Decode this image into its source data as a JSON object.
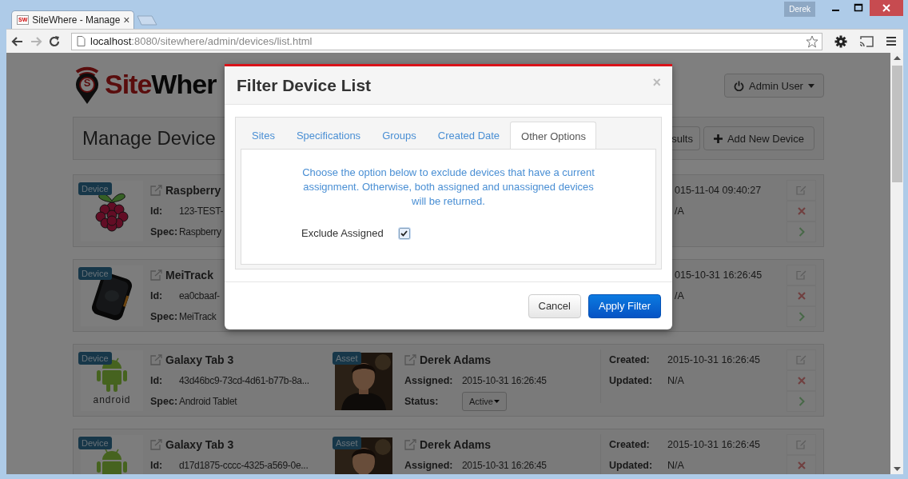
{
  "browser": {
    "profile": "Derek",
    "tab": {
      "favicon": "SW",
      "title": "SiteWhere - Manage",
      "close": "×"
    },
    "nav": {
      "forward_disabled": true
    },
    "url": {
      "host": "localhost",
      "path": ":8080/sitewhere/admin/devices/list.html"
    }
  },
  "page": {
    "logo": {
      "mark": "S",
      "part_1": "Site",
      "part_2": "Wher"
    },
    "user_menu": "Admin User",
    "title": "Manage Device",
    "header_buttons": [
      {
        "kind": "plain",
        "label": "sults"
      },
      {
        "kind": "add",
        "label": "Add New Device"
      }
    ],
    "devices": [
      {
        "badge": "Device",
        "kind": "raspberry",
        "title": "Raspberry",
        "id_label": "Id:",
        "id": "123-TEST-",
        "spec_label": "Spec:",
        "spec": "Raspberry",
        "created": "015-11-04 09:40:27",
        "updated": "/A",
        "actions": [
          {
            "kind": "edit"
          },
          {
            "kind": "delete"
          },
          {
            "kind": "open"
          }
        ]
      },
      {
        "badge": "Device",
        "kind": "tracker",
        "title": "MeiTrack",
        "id_label": "Id:",
        "id": "ea0cbaaf-",
        "spec_label": "Spec:",
        "spec": "MeiTrack",
        "created": "015-10-31 16:26:45",
        "updated": "/A",
        "actions": [
          {
            "kind": "edit"
          },
          {
            "kind": "delete"
          },
          {
            "kind": "open"
          }
        ]
      },
      {
        "badge": "Device",
        "kind": "android",
        "image_text": "android",
        "title": "Galaxy Tab 3",
        "id_label": "Id:",
        "id": "43d46bc9-73cd-4d61-b77b-8a...",
        "spec_label": "Spec:",
        "spec": "Android Tablet",
        "asset": {
          "badge": "Asset",
          "kind": "picture",
          "name": "Derek Adams",
          "assigned_label": "Assigned:",
          "assigned": "2015-10-31 16:26:45",
          "status_label": "Status:",
          "status": "Active"
        },
        "created_label": "Created:",
        "created": "2015-10-31 16:26:45",
        "updated_label": "Updated:",
        "updated": "N/A",
        "actions": [
          {
            "kind": "edit"
          },
          {
            "kind": "delete"
          },
          {
            "kind": "open"
          }
        ]
      },
      {
        "badge": "Device",
        "kind": "android",
        "title": "Galaxy Tab 3",
        "id_label": "Id:",
        "id": "d17d1875-cccc-4325-a569-0e...",
        "asset": {
          "badge": "Asset",
          "kind": "picture",
          "name": "Derek Adams",
          "assigned_label": "Assigned:",
          "assigned": "2015-10-31 16:26:45"
        },
        "created_label": "Created:",
        "created": "2015-10-31 16:26:45",
        "updated_label": "Updated:",
        "updated": "N/A",
        "actions": [
          {
            "kind": "edit"
          },
          {
            "kind": "delete"
          }
        ]
      }
    ]
  },
  "modal": {
    "title": "Filter Device List",
    "close": "×",
    "tabs": [
      {
        "label": "Sites",
        "selected": false
      },
      {
        "label": "Specifications",
        "selected": false
      },
      {
        "label": "Groups",
        "selected": false
      },
      {
        "label": "Created Date",
        "selected": false
      },
      {
        "label": "Other Options",
        "selected": true
      }
    ],
    "message": "Choose the option below to exclude devices that have a current assignment. Otherwise, both assigned and unassigned devices will be returned.",
    "option": {
      "label": "Exclude Assigned",
      "checked": true
    },
    "buttons": [
      {
        "kind": "default",
        "label": "Cancel"
      },
      {
        "kind": "primary",
        "label": "Apply Filter"
      }
    ]
  }
}
